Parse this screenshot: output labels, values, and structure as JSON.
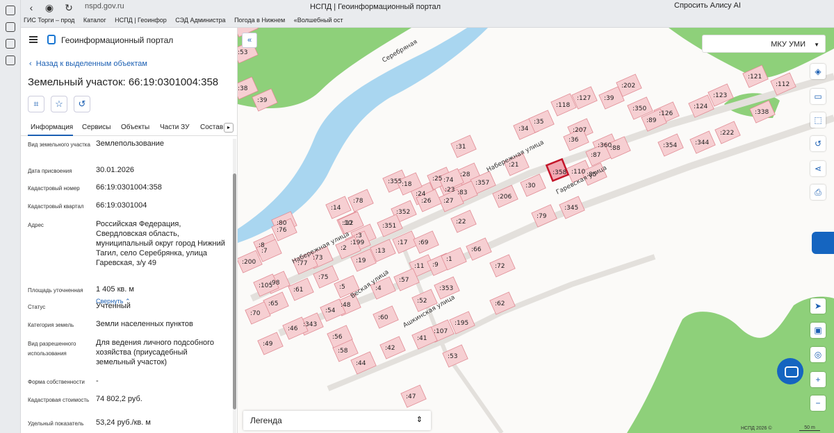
{
  "browser": {
    "url": "nspd.gov.ru",
    "tab_title": "НСПД | Геоинформационный портал",
    "alice_label": "Спросить Алису AI",
    "bookmarks": [
      "ГИС Торги – прод",
      "Каталог",
      "НСПД | Геоинфор",
      "СЭД Администра",
      "Погода в Нижнем",
      "«Волшебный ост"
    ]
  },
  "panel": {
    "portal_title": "Геоинформационный портал",
    "back_label": "Назад к выделенным объектам",
    "parcel_title": "Земельный участок: 66:19:0301004:358",
    "tabs": [
      "Информация",
      "Сервисы",
      "Объекты",
      "Части ЗУ",
      "Состав"
    ],
    "collapse_label": "Свернуть",
    "properties": [
      {
        "label": "Вид земельного участка",
        "value": "Землепользование"
      },
      {
        "label": "Дата присвоения",
        "value": "30.01.2026"
      },
      {
        "label": "Кадастровый номер",
        "value": "66:19:0301004:358"
      },
      {
        "label": "Кадастровый квартал",
        "value": "66:19:0301004"
      },
      {
        "label": "Адрес",
        "value": "Российская Федерация, Свердловская область, муниципальный округ город Нижний Тагил, село Серебрянка, улица Гаревская, з/у 49"
      },
      {
        "label": "Площадь уточненная",
        "value": "1 405 кв. м"
      },
      {
        "label": "Статус",
        "value": "Учтенный"
      },
      {
        "label": "Категория земель",
        "value": "Земли населенных пунктов"
      },
      {
        "label": "Вид разрешенного использования",
        "value": "Для ведения личного подсобного хозяйства (приусадебный земельный участок)"
      },
      {
        "label": "Форма собственности",
        "value": "-"
      },
      {
        "label": "Кадастровая стоимость",
        "value": "74 802,2 руб."
      },
      {
        "label": "Удельный показатель",
        "value": "53,24 руб./кв. м"
      }
    ]
  },
  "map": {
    "org_select": "МКУ УМИ",
    "legend_label": "Легенда",
    "copyright": "НСПД 2026 ©",
    "scale": "50 m",
    "streets": [
      "Серебряная",
      "Набережная улица",
      "Гаревская улица",
      "Набережная улица",
      "Веская улица",
      "Ашкинская улица"
    ],
    "selected_lot": ":358",
    "lots": [
      ":53",
      ":38",
      ":39",
      ":118",
      ":127",
      ":39",
      ":202",
      ":350",
      ":121",
      ":112",
      ":123",
      ":126",
      ":124",
      ":89",
      ":338",
      ":222",
      ":344",
      ":354",
      ":34",
      ":35",
      ":207",
      ":36",
      ":360",
      ":87",
      ":88",
      ":31",
      ":28",
      ":25",
      ":23",
      ":24",
      ":21",
      ":110",
      ":85",
      ":355",
      ":18",
      ":74",
      ":357",
      ":30",
      ":83",
      ":27",
      ":26",
      ":206",
      ":345",
      ":78",
      ":14",
      ":10",
      ":12",
      ":352",
      ":351",
      ":22",
      ":79",
      ":80",
      ":76",
      ":8",
      ":7",
      ":3",
      ":199",
      ":2",
      ":13",
      ":19",
      ":17",
      ":69",
      ":66",
      ":73",
      ":77",
      ":200",
      ":11",
      ":9",
      ":1",
      ":72",
      ":75",
      ":98",
      ":105",
      ":61",
      ":5",
      ":4",
      ":57",
      ":353",
      ":65",
      ":70",
      ":48",
      ":54",
      ":52",
      ":62",
      ":60",
      ":195",
      ":343",
      ":46",
      ":107",
      ":58",
      ":56",
      ":49",
      ":42",
      ":41",
      ":53",
      ":44",
      ":47",
      ":51",
      ":43",
      ":356"
    ],
    "colors": {
      "water": "#a9d6f0",
      "forest": "#8ed07a",
      "lot_fill": "#f6cfd2",
      "lot_stroke": "#e08a93",
      "selected": "#c4162a"
    }
  }
}
